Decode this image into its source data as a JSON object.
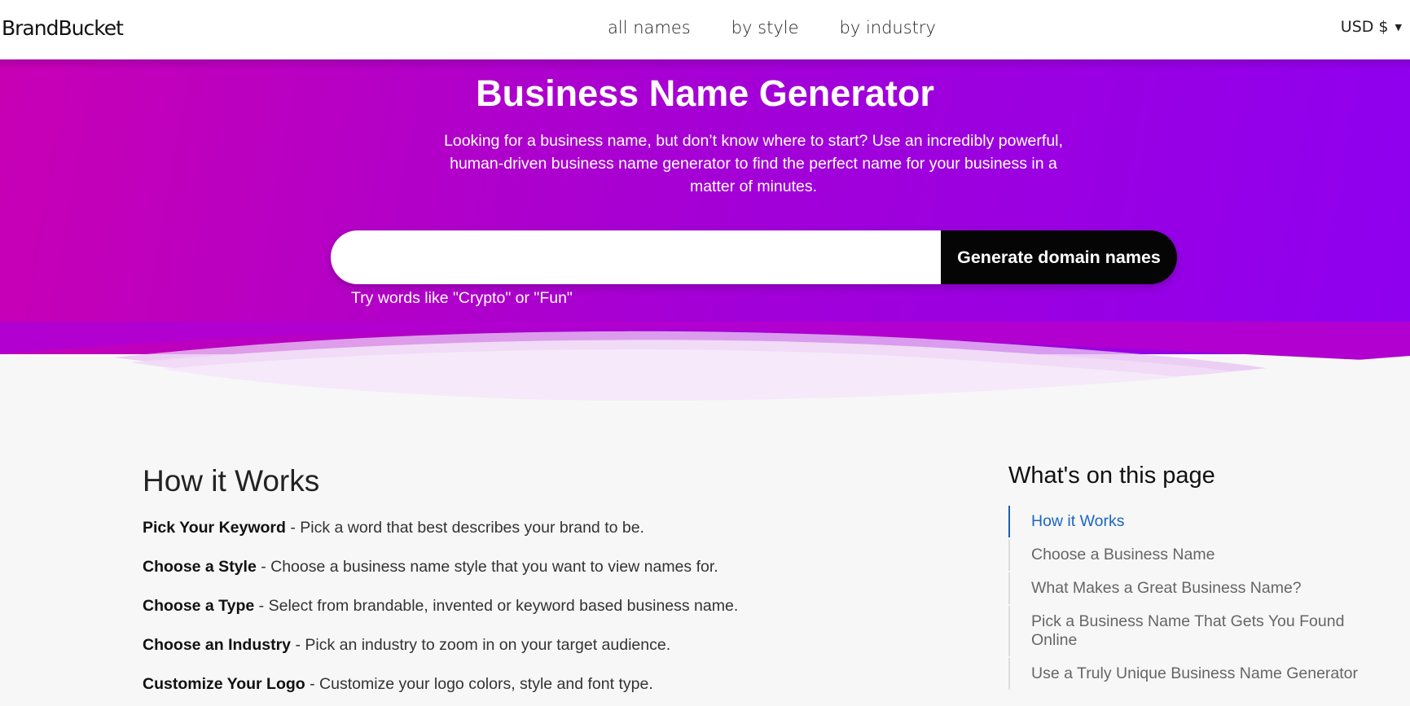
{
  "header": {
    "logo": "BrandBucket",
    "nav": [
      "all names",
      "by style",
      "by industry"
    ],
    "currency": "USD $"
  },
  "hero": {
    "title": "Business Name Generator",
    "subtitle": "Looking for a business name, but don’t know where to start? Use an incredibly powerful, human-driven business name generator to find the perfect name for your business in a matter of minutes.",
    "search_placeholder": "",
    "search_value": "",
    "button_label": "Generate domain names",
    "hint": "Try words like \"Crypto\" or \"Fun\""
  },
  "main": {
    "heading": "How it Works",
    "steps": [
      {
        "bold": "Pick Your Keyword",
        "text": " - Pick a word that best describes your brand to be."
      },
      {
        "bold": "Choose a Style",
        "text": " - Choose a business name style that you want to view names for."
      },
      {
        "bold": "Choose a Type",
        "text": " - Select from brandable, invented or keyword based business name."
      },
      {
        "bold": "Choose an Industry",
        "text": " - Pick an industry to zoom in on your target audience."
      },
      {
        "bold": "Customize Your Logo",
        "text": " - Customize your logo colors, style and font type."
      }
    ]
  },
  "toc": {
    "heading": "What's on this page",
    "items": [
      "How it Works",
      "Choose a Business Name",
      "What Makes a Great Business Name?",
      "Pick a Business Name That Gets You Found Online",
      "Use a Truly Unique Business Name Generator"
    ],
    "active_index": 0
  },
  "colors": {
    "gradient_start": "#c800b4",
    "gradient_end": "#8e00f0",
    "button": "#050505",
    "toc_active": "#1a66c2"
  }
}
